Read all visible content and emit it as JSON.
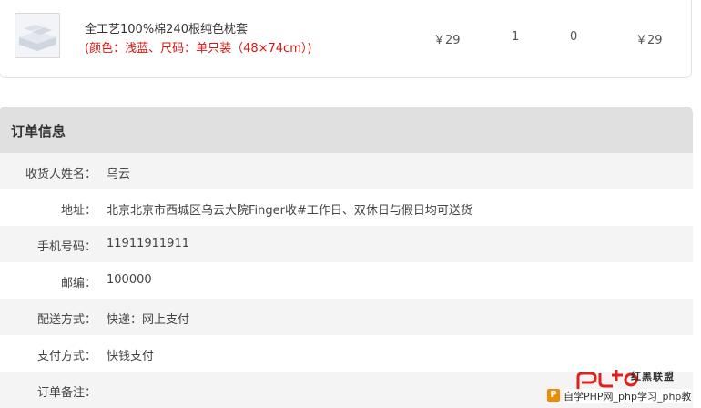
{
  "product": {
    "name": "全工艺100%棉240根纯色枕套",
    "spec": "(颜色：浅蓝、尺码：单只装（48×74cm）)",
    "price": "￥29",
    "quantity": "1",
    "discount": "0",
    "subtotal": "￥29"
  },
  "order_info": {
    "title": "订单信息",
    "rows": [
      {
        "label": "收货人姓名：",
        "value": "乌云"
      },
      {
        "label": "地址：",
        "value": "北京北京市西城区乌云大院Finger收#工作日、双休日与假日均可送货"
      },
      {
        "label": "手机号码：",
        "value": "11911911911"
      },
      {
        "label": "邮编：",
        "value": "100000"
      },
      {
        "label": "配送方式：",
        "value": "快递：网上支付"
      },
      {
        "label": "支付方式：",
        "value": "快钱支付"
      },
      {
        "label": "订单备注：",
        "value": ""
      }
    ]
  },
  "watermark": {
    "brand": "红黑联盟",
    "caption": "自学PHP网_php学习_php教"
  },
  "colors": {
    "spec_red": "#d9140f",
    "header_gray": "#e0e0e0",
    "row_alt": "#f4f4f4",
    "watermark_red": "#e0201b"
  },
  "icons": {
    "product_image": "pillowcase-thumbnail",
    "watermark_icon": "p-logo-icon"
  }
}
